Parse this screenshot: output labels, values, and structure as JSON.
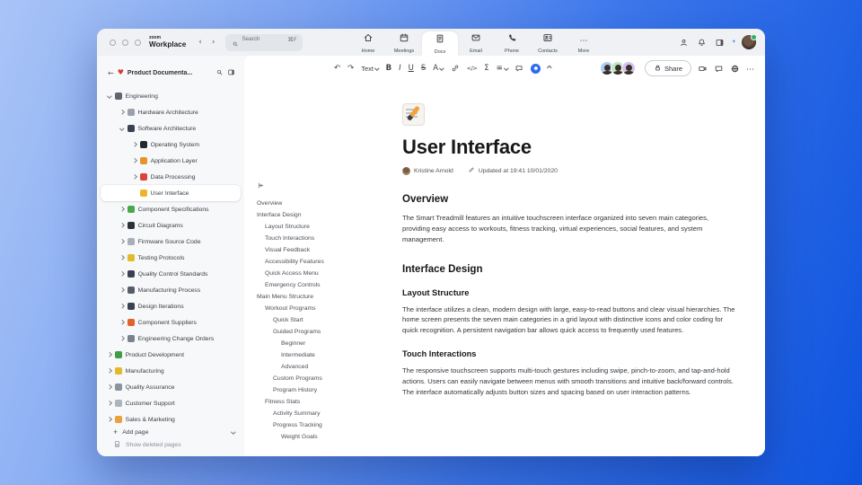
{
  "colors": {
    "accent_blue": "#2e6bf0",
    "online_green": "#2fb061",
    "workspace_icon_red": "#d63a2f"
  },
  "titlebar": {
    "logo_top": "zoom",
    "logo_name": "Workplace",
    "nav_back": "‹",
    "nav_forward": "›",
    "search": {
      "placeholder": "Search",
      "shortcut": "⌘F"
    },
    "tabs": [
      {
        "label": "Home",
        "icon": "home-icon",
        "active": false
      },
      {
        "label": "Meetings",
        "icon": "calendar-icon",
        "active": false
      },
      {
        "label": "Docs",
        "icon": "doc-icon",
        "active": true
      },
      {
        "label": "Email",
        "icon": "envelope-icon",
        "active": false
      },
      {
        "label": "Phone",
        "icon": "phone-icon",
        "active": false
      },
      {
        "label": "Contacts",
        "icon": "contact-card-icon",
        "active": false
      },
      {
        "label": "More",
        "icon": "more-icon",
        "active": false
      }
    ],
    "right_icons": [
      {
        "name": "status-person-icon",
        "svg": "person-icon"
      },
      {
        "name": "notifications-bell-icon",
        "svg": "bell-icon"
      },
      {
        "name": "side-panel-toggle-icon",
        "svg": "panel-icon"
      },
      {
        "name": "ai-sparkle-icon",
        "kind": "sparkle"
      }
    ]
  },
  "sidebar": {
    "back_glyph": "←",
    "workspace_icon_glyph": "♥",
    "title": "Product Documenta...",
    "items": [
      {
        "level": 0,
        "state": "expanded",
        "icon": "gear-icon",
        "color": "#5f6670",
        "label": "Engineering"
      },
      {
        "level": 1,
        "state": "collapsed",
        "icon": "keyboard-icon",
        "color": "#9aa1ab",
        "label": "Hardware Architecture"
      },
      {
        "level": 1,
        "state": "expanded",
        "icon": "monitor-icon",
        "color": "#3a4150",
        "label": "Software Architecture"
      },
      {
        "level": 2,
        "state": "collapsed",
        "icon": "smartphone-icon",
        "color": "#23272e",
        "label": "Operating System"
      },
      {
        "level": 2,
        "state": "collapsed",
        "icon": "layers-icon",
        "color": "#e8922a",
        "label": "Application Layer"
      },
      {
        "level": 2,
        "state": "collapsed",
        "icon": "chart-up-icon",
        "color": "#d8453a",
        "label": "Data Processing"
      },
      {
        "level": 2,
        "state": "leaf",
        "icon": "memo-icon",
        "color": "#f0b429",
        "label": "User Interface",
        "selected": true
      },
      {
        "level": 1,
        "state": "collapsed",
        "icon": "puzzle-icon",
        "color": "#49a84c",
        "label": "Component Specifications"
      },
      {
        "level": 1,
        "state": "collapsed",
        "icon": "fountain-pen-icon",
        "color": "#2d3138",
        "label": "Circuit Diagrams"
      },
      {
        "level": 1,
        "state": "collapsed",
        "icon": "wrench-icon",
        "color": "#a8afb8",
        "label": "Firmware Source Code"
      },
      {
        "level": 1,
        "state": "collapsed",
        "icon": "worker-icon",
        "color": "#e3b92e",
        "label": "Testing Protocols"
      },
      {
        "level": 1,
        "state": "collapsed",
        "icon": "traffic-light-icon",
        "color": "#3a4150",
        "label": "Quality Control Standards"
      },
      {
        "level": 1,
        "state": "collapsed",
        "icon": "tool-icon",
        "color": "#565d66",
        "label": "Manufacturing Process"
      },
      {
        "level": 1,
        "state": "collapsed",
        "icon": "camera-icon",
        "color": "#3a4150",
        "label": "Design Iterations"
      },
      {
        "level": 1,
        "state": "collapsed",
        "icon": "truck-icon",
        "color": "#e2622b",
        "label": "Component Suppliers"
      },
      {
        "level": 1,
        "state": "collapsed",
        "icon": "globe-icon",
        "color": "#7c828c",
        "label": "Engineering Change Orders"
      },
      {
        "level": 0,
        "state": "collapsed",
        "icon": "pencil-icon",
        "color": "#3f9d42",
        "label": "Product Development"
      },
      {
        "level": 0,
        "state": "collapsed",
        "icon": "worker-icon",
        "color": "#e3b92e",
        "label": "Manufacturing"
      },
      {
        "level": 0,
        "state": "collapsed",
        "icon": "microscope-icon",
        "color": "#8d939c",
        "label": "Quality Assurance"
      },
      {
        "level": 0,
        "state": "collapsed",
        "icon": "speech-bubble-icon",
        "color": "#aeb4bc",
        "label": "Customer Support"
      },
      {
        "level": 0,
        "state": "collapsed",
        "icon": "bar-chart-icon",
        "color": "#e8a23a",
        "label": "Sales & Marketing"
      }
    ],
    "add_page_label": "Add page",
    "add_page_plus": "+",
    "show_deleted_label": "Show deleted pages"
  },
  "toolbar": {
    "left_items": [
      {
        "name": "undo-button",
        "glyph": "↶"
      },
      {
        "name": "redo-button",
        "glyph": "↷"
      },
      {
        "name": "text-style-dropdown",
        "label": "Text",
        "chev": true
      },
      {
        "name": "bold-button",
        "glyph": "B",
        "cls": "fb"
      },
      {
        "name": "italic-button",
        "glyph": "I",
        "cls": "fi"
      },
      {
        "name": "underline-button",
        "glyph": "U",
        "cls": "fu"
      },
      {
        "name": "strikethrough-button",
        "glyph": "S",
        "cls": "fs"
      },
      {
        "name": "text-color-dropdown",
        "glyph": "A",
        "chev": true
      },
      {
        "name": "link-button",
        "svg": "link-icon"
      },
      {
        "name": "code-button",
        "glyph": "</>",
        "cls": "code"
      },
      {
        "name": "equation-button",
        "glyph": "Σ"
      },
      {
        "name": "list-format-dropdown",
        "glyph": "≡",
        "chev": true
      },
      {
        "name": "comment-button",
        "svg": "comment-icon"
      },
      {
        "name": "ai-companion-button",
        "kind": "ai"
      },
      {
        "name": "collapse-toolbar-button",
        "kind": "chev-up"
      }
    ],
    "collaborator_avatars": [
      {
        "bg": "#aecdf5"
      },
      {
        "bg": "#bfe6c6"
      },
      {
        "bg": "#d3c3ef"
      }
    ],
    "share_label": "Share",
    "right_icons": [
      {
        "name": "video-call-button",
        "svg": "video-icon"
      },
      {
        "name": "chat-button",
        "svg": "comment-icon"
      },
      {
        "name": "web-publish-button",
        "svg": "globe-icon"
      },
      {
        "name": "more-options-button",
        "glyph": "⋯"
      }
    ]
  },
  "outline": {
    "items": [
      {
        "level": 0,
        "label": "Overview"
      },
      {
        "level": 0,
        "label": "Interface Design"
      },
      {
        "level": 1,
        "label": "Layout Structure"
      },
      {
        "level": 1,
        "label": "Touch Interactions"
      },
      {
        "level": 1,
        "label": "Visual Feedback"
      },
      {
        "level": 1,
        "label": "Accessibility Features"
      },
      {
        "level": 1,
        "label": "Quick Access Menu"
      },
      {
        "level": 1,
        "label": "Emergency Controls"
      },
      {
        "level": 0,
        "label": "Main Menu Structure"
      },
      {
        "level": 1,
        "label": "Workout Programs"
      },
      {
        "level": 2,
        "label": "Quick Start"
      },
      {
        "level": 2,
        "label": "Guided Programs"
      },
      {
        "level": 3,
        "label": "Beginner"
      },
      {
        "level": 3,
        "label": "Intermediate"
      },
      {
        "level": 3,
        "label": "Advanced"
      },
      {
        "level": 2,
        "label": "Custom Programs"
      },
      {
        "level": 2,
        "label": "Program History"
      },
      {
        "level": 1,
        "label": "Fitness Stats"
      },
      {
        "level": 2,
        "label": "Activity Summary"
      },
      {
        "level": 2,
        "label": "Progress Tracking"
      },
      {
        "level": 3,
        "label": "Weight Goals"
      }
    ]
  },
  "doc": {
    "title": "User Interface",
    "author": "Kristine Arnold",
    "updated": "Updated at 19:41 10/01/2020",
    "sections": [
      {
        "type": "h2",
        "text": "Overview"
      },
      {
        "type": "p",
        "text": "The Smart Treadmill features an intuitive touchscreen interface organized into seven main categories, providing easy access to workouts, fitness tracking, virtual experiences, social features, and system management."
      },
      {
        "type": "h2",
        "text": "Interface Design"
      },
      {
        "type": "h3",
        "text": "Layout Structure"
      },
      {
        "type": "p",
        "text": "The interface utilizes a clean, modern design with large, easy-to-read buttons and clear visual hierarchies. The home screen presents the seven main categories in a grid layout with distinctive icons and color coding for quick recognition. A persistent navigation bar allows quick access to frequently used features."
      },
      {
        "type": "h3",
        "text": "Touch Interactions"
      },
      {
        "type": "p",
        "text": "The responsive touchscreen supports multi-touch gestures including swipe, pinch-to-zoom, and tap-and-hold actions. Users can easily navigate between menus with smooth transitions and intuitive back/forward controls. The interface automatically adjusts button sizes and spacing based on user interaction patterns."
      }
    ]
  }
}
